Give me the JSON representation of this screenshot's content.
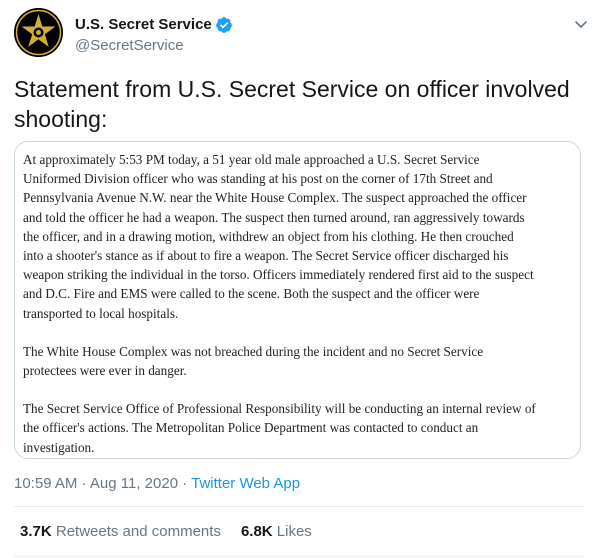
{
  "account": {
    "display_name": "U.S. Secret Service",
    "handle": "@SecretService",
    "avatar_icon": "secret-service-star-badge",
    "verified_icon": "verified-badge-icon",
    "verified_color": "#1da1f2"
  },
  "tweet": {
    "text": "Statement from U.S. Secret Service on officer involved shooting:"
  },
  "statement": {
    "paragraph1": "At approximately 5:53 PM today, a 51 year old male approached a U.S. Secret Service\nUniformed Division officer who was standing at his post on the corner of 17th Street and\nPennsylvania Avenue N.W. near the White House Complex.  The suspect approached the officer\nand told the officer he had a weapon.  The suspect then turned around, ran aggressively towards\nthe officer, and in a drawing motion, withdrew an object from his clothing.  He then crouched\ninto a shooter's stance as if about to fire a weapon. The Secret Service officer discharged his\nweapon striking the individual in the torso. Officers immediately rendered first aid to the suspect\nand D.C. Fire and EMS were called to the scene. Both the suspect and the officer were\ntransported to local hospitals.",
    "paragraph2": "The White House Complex was not breached during the incident and no Secret Service\nprotectees were ever in danger.",
    "paragraph3": "The Secret Service Office of Professional Responsibility will be conducting an internal review of\nthe officer's actions. The Metropolitan Police Department was contacted to conduct an\ninvestigation."
  },
  "meta": {
    "time": "10:59 AM",
    "separator1": " · ",
    "date": "Aug 11, 2020",
    "separator2": " · ",
    "source": "Twitter Web App",
    "source_color": "#1b95e0"
  },
  "stats": {
    "retweets_count": "3.7K",
    "retweets_label": " Retweets and comments",
    "likes_count": "6.8K",
    "likes_label": " Likes"
  },
  "more_menu_icon": "chevron-down-icon"
}
